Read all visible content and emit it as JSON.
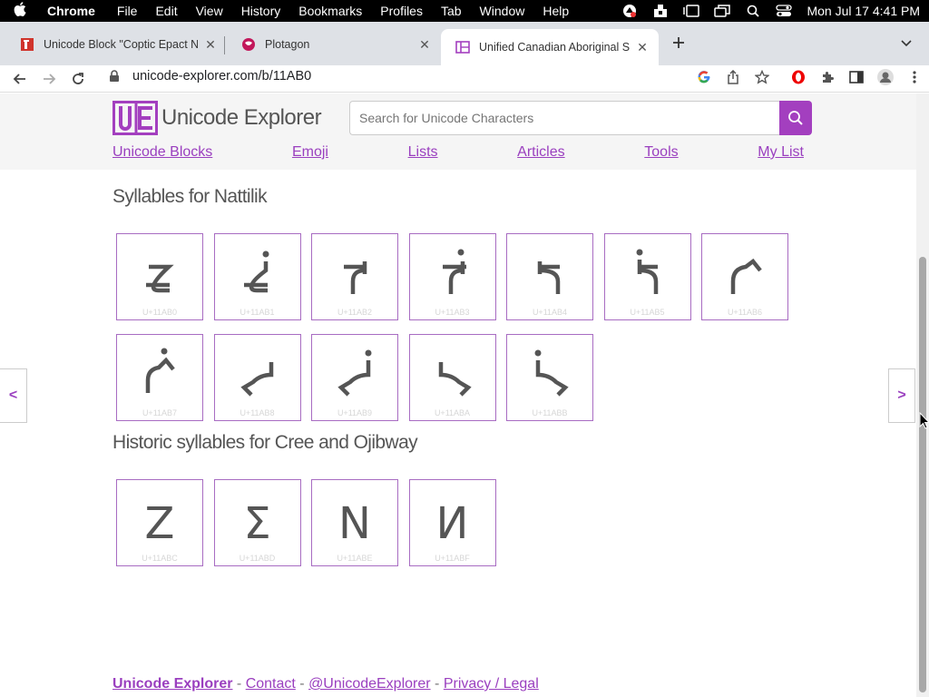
{
  "menubar": {
    "apple": "",
    "app_name": "Chrome",
    "items": [
      "File",
      "Edit",
      "View",
      "History",
      "Bookmarks",
      "Profiles",
      "Tab",
      "Window",
      "Help"
    ],
    "clock": "Mon Jul 17  4:41 PM"
  },
  "tabs": [
    {
      "title": "Unicode Block \"Coptic Epact N",
      "active": false
    },
    {
      "title": "Plotagon",
      "active": false
    },
    {
      "title": "Unified Canadian Aboriginal Sy",
      "active": true
    }
  ],
  "toolbar": {
    "url": "unicode-explorer.com/b/11AB0"
  },
  "site": {
    "logo_text": "Unicode Explorer",
    "search_placeholder": "Search for Unicode Characters",
    "nav": [
      "Unicode Blocks",
      "Emoji",
      "Lists",
      "Articles",
      "Tools",
      "My List"
    ],
    "accent": "#a33fbf"
  },
  "sections": [
    {
      "title": "Syllables for Nattilik",
      "chars": [
        {
          "code": "U+11AB0",
          "glyph": "u11ab0"
        },
        {
          "code": "U+11AB1",
          "glyph": "u11ab1"
        },
        {
          "code": "U+11AB2",
          "glyph": "u11ab2"
        },
        {
          "code": "U+11AB3",
          "glyph": "u11ab3"
        },
        {
          "code": "U+11AB4",
          "glyph": "u11ab4"
        },
        {
          "code": "U+11AB5",
          "glyph": "u11ab5"
        },
        {
          "code": "U+11AB6",
          "glyph": "u11ab6"
        },
        {
          "code": "U+11AB7",
          "glyph": "u11ab7"
        },
        {
          "code": "U+11AB8",
          "glyph": "u11ab8"
        },
        {
          "code": "U+11AB9",
          "glyph": "u11ab9"
        },
        {
          "code": "U+11ABA",
          "glyph": "u11aba"
        },
        {
          "code": "U+11ABB",
          "glyph": "u11abb"
        }
      ]
    },
    {
      "title": "Historic syllables for Cree and Ojibway",
      "chars": [
        {
          "code": "U+11ABC",
          "char": "Z"
        },
        {
          "code": "U+11ABD",
          "char": "Σ"
        },
        {
          "code": "U+11ABE",
          "char": "N"
        },
        {
          "code": "U+11ABF",
          "char": "И"
        }
      ]
    }
  ],
  "pager": {
    "prev": "<",
    "next": ">"
  },
  "footer": {
    "brand": "Unicode Explorer",
    "sep": " - ",
    "links": [
      "Contact",
      "@UnicodeExplorer",
      "Privacy / Legal"
    ]
  }
}
